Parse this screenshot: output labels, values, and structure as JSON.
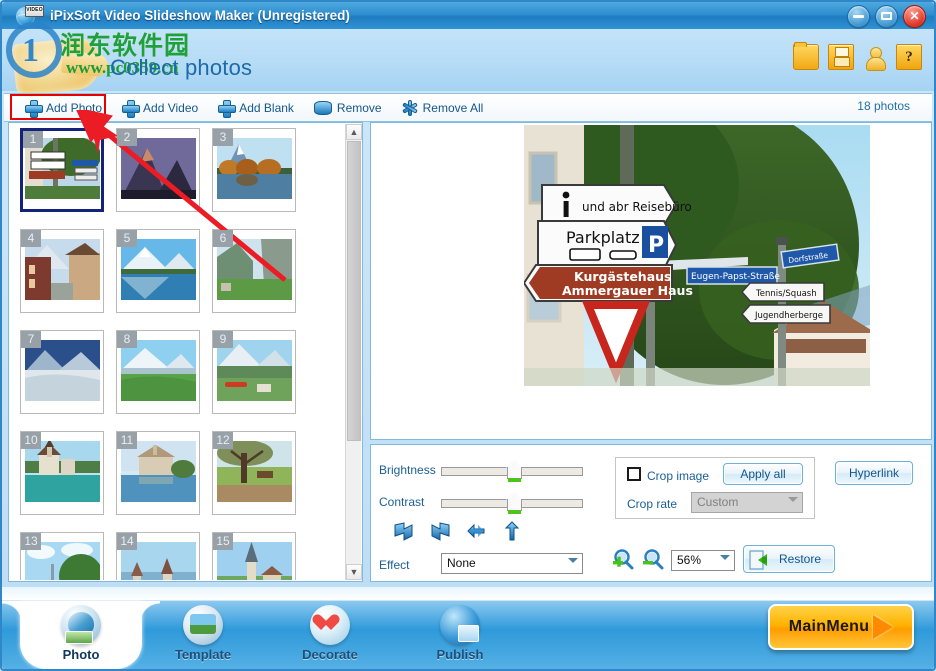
{
  "window": {
    "title": "iPixSoft Video Slideshow Maker (Unregistered)",
    "app_icon": "video-globe-icon",
    "badge_text": "VIDEO",
    "minimize_label": "Minimize",
    "maximize_label": "Maximize",
    "close_label": "Close"
  },
  "header": {
    "page_title": "Collect photos",
    "icons": [
      {
        "name": "open-project-icon",
        "label": "Open"
      },
      {
        "name": "save-project-icon",
        "label": "Save"
      },
      {
        "name": "user-account-icon",
        "label": "Account"
      },
      {
        "name": "help-icon",
        "label": "Help"
      }
    ],
    "watermark": {
      "digit": "1",
      "cn_text": "润东软件园",
      "url": "www.pc0359.cn"
    }
  },
  "toolbar": {
    "items": [
      {
        "label": "Add Photo",
        "icon": "plus-icon",
        "highlighted": true
      },
      {
        "label": "Add Video",
        "icon": "plus-icon",
        "highlighted": false
      },
      {
        "label": "Add Blank",
        "icon": "plus-icon",
        "highlighted": false
      },
      {
        "label": "Remove",
        "icon": "remove-bar-icon",
        "highlighted": false
      },
      {
        "label": "Remove All",
        "icon": "remove-all-star-icon",
        "highlighted": false
      }
    ],
    "photo_count": "18 photos"
  },
  "thumbnails": {
    "selected_index": 1,
    "items": [
      {
        "num": "1",
        "alt": "street signs"
      },
      {
        "num": "2",
        "alt": "matterhorn at dusk"
      },
      {
        "num": "3",
        "alt": "lake reflection autumn"
      },
      {
        "num": "4",
        "alt": "alpine village street"
      },
      {
        "num": "5",
        "alt": "matterhorn lake reflection"
      },
      {
        "num": "6",
        "alt": "green valley cliff"
      },
      {
        "num": "7",
        "alt": "glacier snow"
      },
      {
        "num": "8",
        "alt": "jungfrau meadow"
      },
      {
        "num": "9",
        "alt": "valley with red train"
      },
      {
        "num": "10",
        "alt": "oberhofen castle"
      },
      {
        "num": "11",
        "alt": "chillon castle"
      },
      {
        "num": "12",
        "alt": "tree and bench"
      },
      {
        "num": "13",
        "alt": "lakeside trees"
      },
      {
        "num": "14",
        "alt": "town skyline"
      },
      {
        "num": "15",
        "alt": "church spire"
      }
    ],
    "scrollbar": {
      "up_arrow": "▲",
      "down_arrow": "▼"
    }
  },
  "preview": {
    "alt": "german street direction signs",
    "signs": [
      "und abr Reisebüro",
      "Parkplatz",
      "P",
      "Kurgästehaus",
      "Ammergauer Haus",
      "Eugen-Papst-Straße",
      "Dorfstraße",
      "Tennis/Squash",
      "Jugendherberge"
    ]
  },
  "controls": {
    "brightness_label": "Brightness",
    "brightness_value": 50,
    "contrast_label": "Contrast",
    "contrast_value": 50,
    "rotate_icons": [
      {
        "name": "rotate-left-icon",
        "label": "Rotate left"
      },
      {
        "name": "rotate-right-icon",
        "label": "Rotate right"
      },
      {
        "name": "flip-horizontal-icon",
        "label": "Flip horizontal"
      },
      {
        "name": "flip-vertical-icon",
        "label": "Flip vertical"
      }
    ],
    "effect_label": "Effect",
    "effect_value": "None",
    "crop_image_label": "Crop image",
    "crop_image_checked": false,
    "apply_all_label": "Apply all",
    "crop_rate_label": "Crop rate",
    "crop_rate_value": "Custom",
    "crop_rate_disabled": true,
    "hyperlink_label": "Hyperlink",
    "zoom_in_label": "Zoom in",
    "zoom_out_label": "Zoom out",
    "zoom_value": "56%",
    "restore_label": "Restore"
  },
  "bottom_nav": {
    "items": [
      {
        "label": "Photo",
        "icon": "photo-icon",
        "active": true
      },
      {
        "label": "Template",
        "icon": "template-icon",
        "active": false
      },
      {
        "label": "Decorate",
        "icon": "decorate-icon",
        "active": false
      },
      {
        "label": "Publish",
        "icon": "publish-icon",
        "active": false
      }
    ],
    "main_menu_label": "MainMenu"
  },
  "annotation": {
    "highlight_target": "Add Photo",
    "arrow_color": "#ec1c24",
    "box_color": "#e60000"
  },
  "colors": {
    "title_blue": "#2e8fcf",
    "header_blue": "#b4dbf6",
    "accent_text": "#1d6aa8",
    "selection_border": "#13237a",
    "main_menu_orange": "#ffb300"
  }
}
